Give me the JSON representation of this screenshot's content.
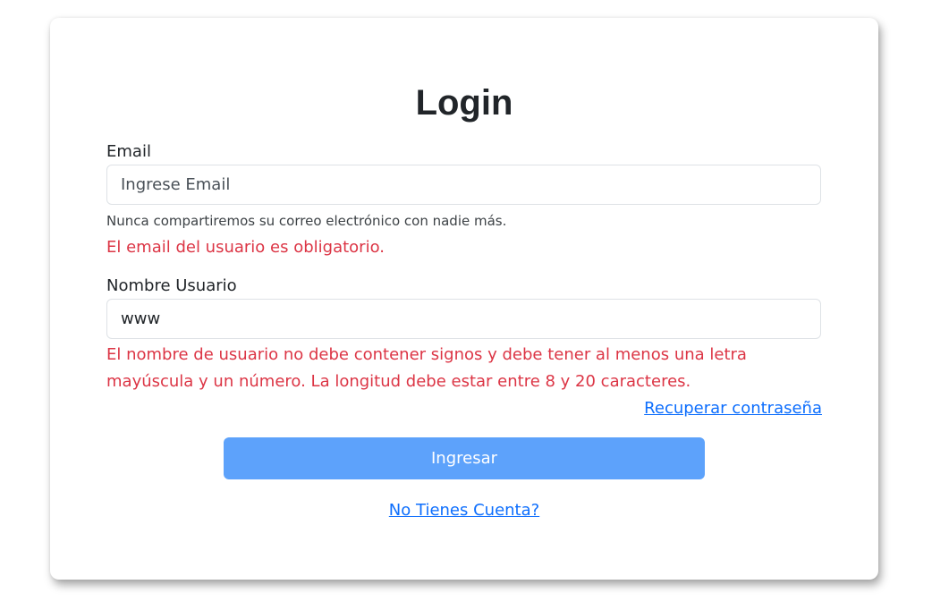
{
  "login": {
    "title": "Login",
    "email": {
      "label": "Email",
      "placeholder": "Ingrese Email",
      "value": "",
      "help": "Nunca compartiremos su correo electrónico con nadie más.",
      "error": "El email del usuario es obligatorio."
    },
    "username": {
      "label": "Nombre Usuario",
      "placeholder": "",
      "value": "www",
      "error": "El nombre de usuario no debe contener signos y debe tener al menos una letra mayúscula y un número. La longitud debe estar entre 8 y 20 caracteres."
    },
    "recover_link": "Recuperar contraseña",
    "submit_label": "Ingresar",
    "signup_link": "No Tienes Cuenta?"
  },
  "colors": {
    "error": "#dc3545",
    "link": "#0d6efd",
    "button_bg": "#5da2fb",
    "button_text": "#ffffff"
  }
}
